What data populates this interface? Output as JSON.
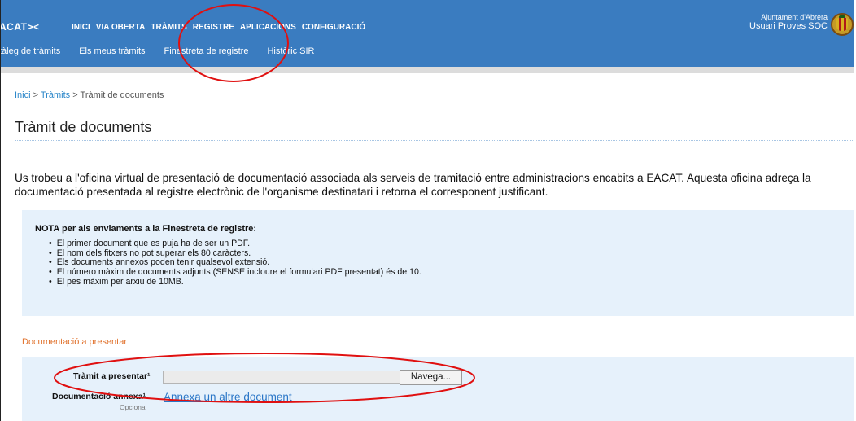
{
  "header": {
    "logo": "ACAT><",
    "main_nav": [
      "INICI",
      "VIA OBERTA",
      "TRÀMITS",
      "REGISTRE",
      "APLICACIONS",
      "CONFIGURACIÓ"
    ],
    "sub_nav": [
      "tàleg de tràmits",
      "Els meus tràmits",
      "Finestreta de registre",
      "Històric SIR"
    ],
    "organization": "Ajuntament d'Abrera",
    "user": "Usuari Proves SOC"
  },
  "breadcrumb": {
    "home": "Inici",
    "sep1": " > ",
    "level1": "Tràmits",
    "sep2": " > ",
    "current": "Tràmit de documents"
  },
  "page_title": "Tràmit de documents",
  "intro_text": "Us trobeu a l'oficina virtual de presentació de documentació associada als serveis de tramitació entre administracions encabits a EACAT. Aquesta oficina adreça la documentació presentada al registre electrònic de l'organisme destinatari i retorna el corresponent justificant.",
  "nota": {
    "title": "NOTA per als enviaments a la Finestreta de registre:",
    "items": [
      "El primer document que es puja ha de ser un PDF.",
      "El nom dels fitxers no pot superar els 80 caràcters.",
      "Els documents annexos poden tenir qualsevol extensió.",
      "El número màxim de documents adjunts (SENSE incloure el formulari PDF presentat) és de 10.",
      "El pes màxim per arxiu de 10MB."
    ]
  },
  "documents": {
    "section_label": "Documentació a presentar",
    "tramit_label": "Tràmit a presentar¹",
    "file_value": "",
    "browse_label": "Navega...",
    "annexa_label": "Documentació annexa¹",
    "optional_label": "Opcional",
    "add_link": "Annexa un altre document"
  },
  "colors": {
    "header_blue": "#3a7cc0",
    "link_blue": "#2a76c7",
    "section_orange": "#e0702a",
    "panel_bg": "#e6f1fb",
    "annotation_red": "#e01010"
  }
}
